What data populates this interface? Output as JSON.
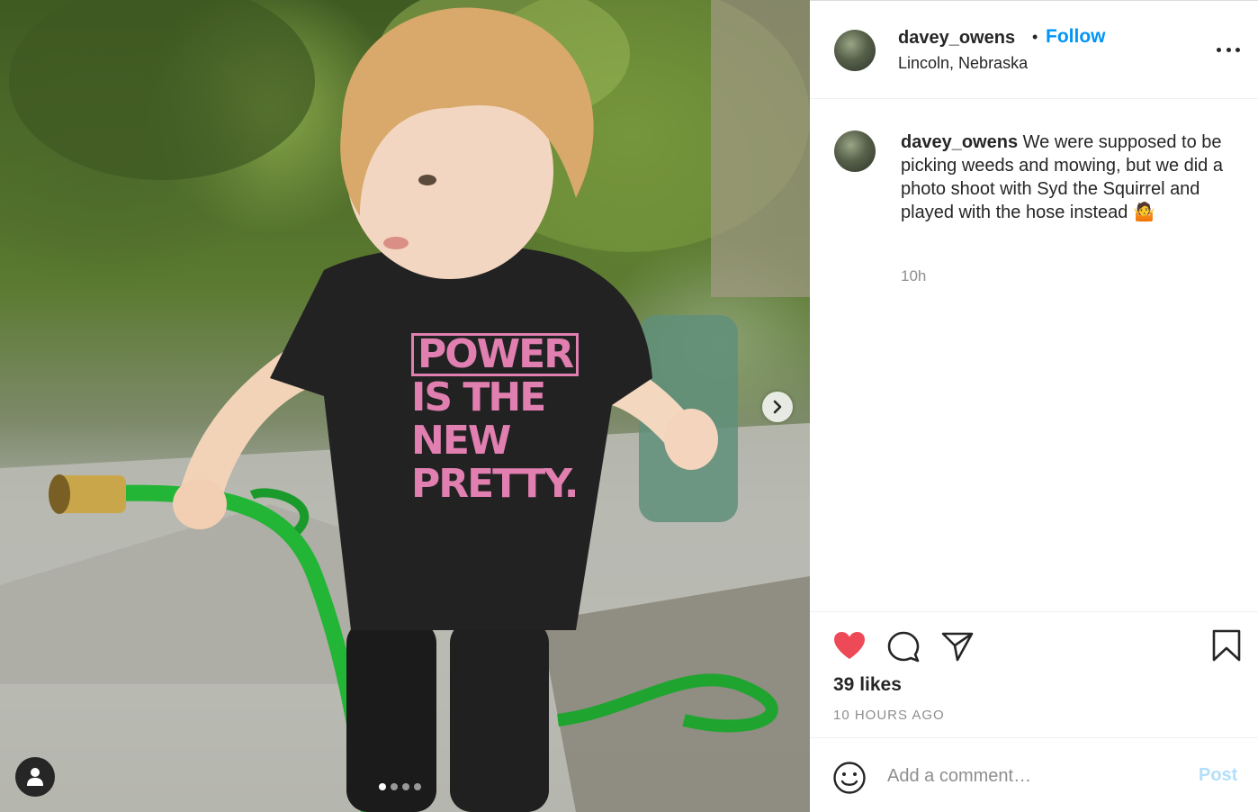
{
  "post": {
    "username": "davey_owens",
    "separator": "•",
    "follow_label": "Follow",
    "location": "Lincoln, Nebraska",
    "caption_text": "We were supposed to be picking weeds and mowing, but we did a photo shoot with Syd the Squirrel and played with the hose instead 🤷",
    "caption_age": "10h",
    "likes_text": "39 likes",
    "posted_ago": "10 HOURS AGO",
    "liked": true
  },
  "media": {
    "shirt_lines": [
      "POWER",
      "IS THE",
      "NEW",
      "PRETTY."
    ],
    "carousel": {
      "count": 4,
      "active_index": 0
    }
  },
  "comment": {
    "placeholder": "Add a comment…",
    "post_label": "Post"
  },
  "icons": {
    "like": "heart-icon",
    "comment": "comment-icon",
    "share": "paper-plane-icon",
    "save": "bookmark-icon",
    "emoji": "smiley-icon",
    "more": "more-options-icon",
    "next": "chevron-right-icon",
    "tag": "user-tag-icon"
  },
  "colors": {
    "like_red": "#ed4956",
    "link_blue": "#0095f6",
    "post_disabled": "#b2dffc",
    "shirt_pink": "#e07fb0"
  }
}
